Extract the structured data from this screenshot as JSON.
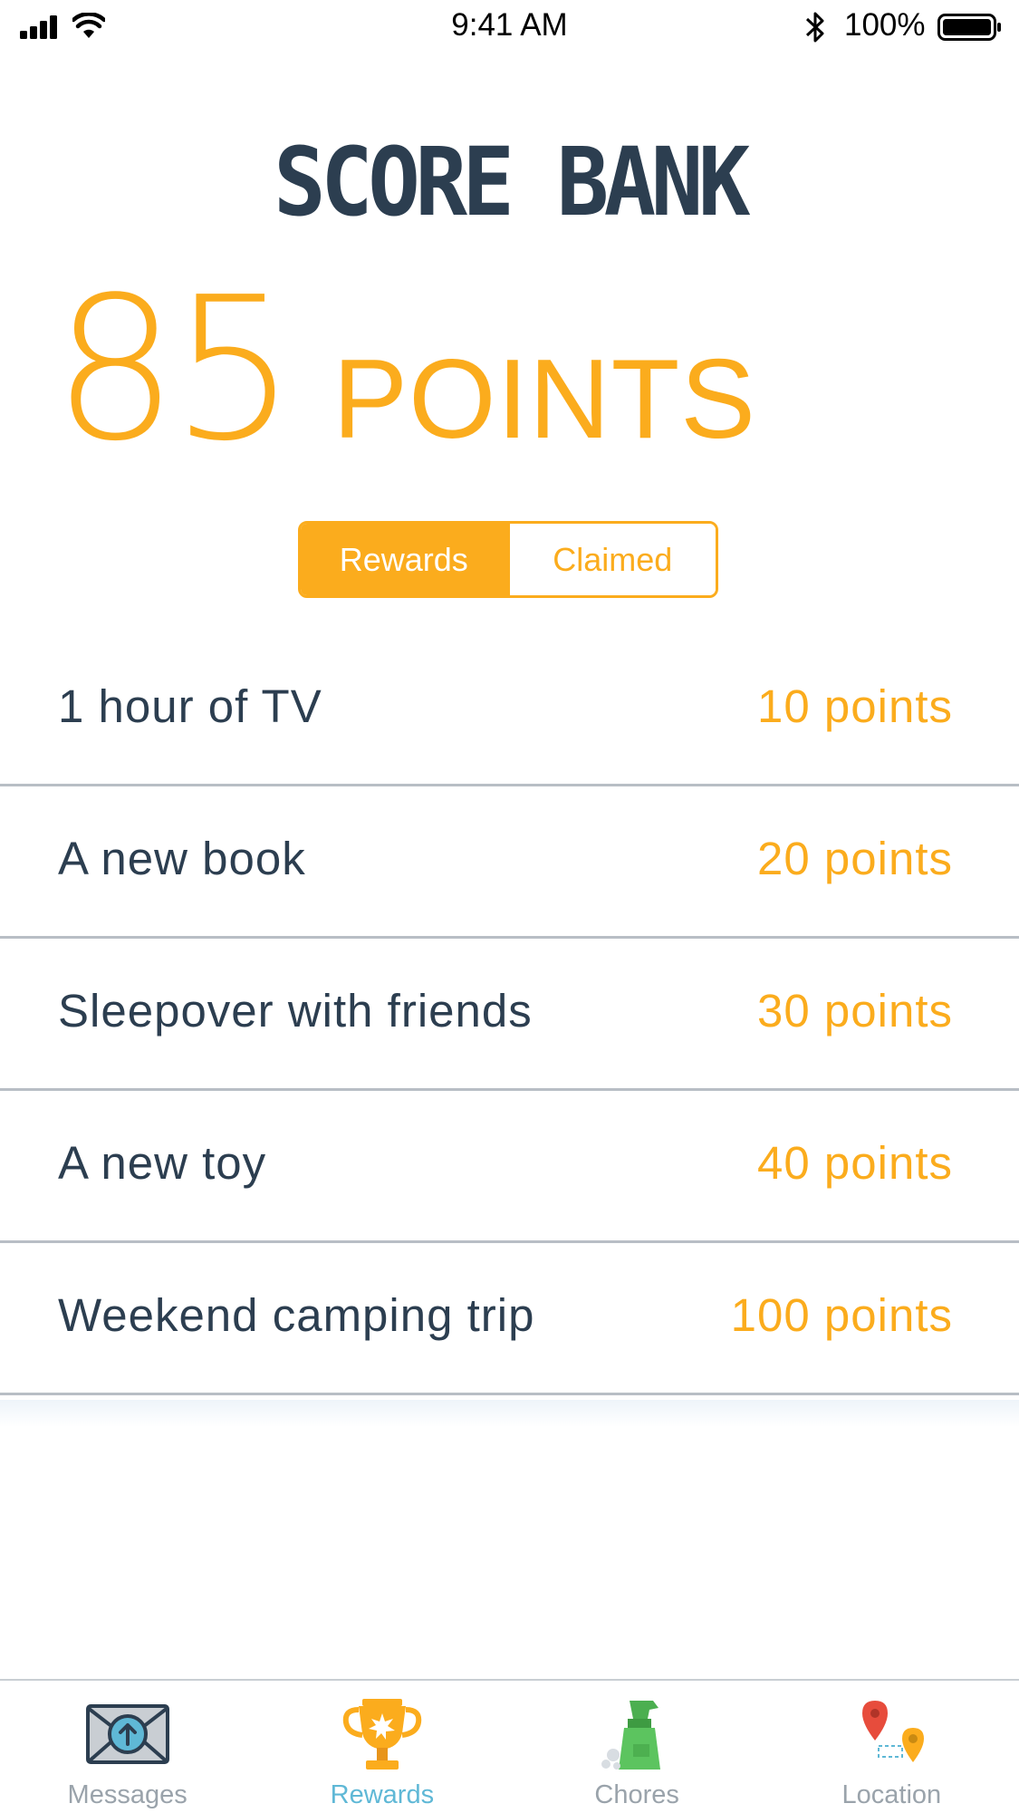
{
  "status_bar": {
    "time": "9:41 AM",
    "battery_percent": "100%",
    "icons": [
      "signal-icon",
      "wifi-icon",
      "bluetooth-icon",
      "battery-icon"
    ]
  },
  "header": {
    "title": "SCORE BANK"
  },
  "balance": {
    "value": "85",
    "unit": "POINTS"
  },
  "segmented": {
    "options": [
      "Rewards",
      "Claimed"
    ],
    "selected": "Rewards"
  },
  "rewards": [
    {
      "name": "1 hour of TV",
      "cost": "10 points"
    },
    {
      "name": "A new book",
      "cost": "20 points"
    },
    {
      "name": "Sleepover with friends",
      "cost": "30 points"
    },
    {
      "name": "A new toy",
      "cost": "40 points"
    },
    {
      "name": "Weekend camping trip",
      "cost": "100 points"
    }
  ],
  "tabbar": {
    "selected": "Rewards",
    "tabs": [
      {
        "label": "Messages",
        "icon": "envelope-icon"
      },
      {
        "label": "Rewards",
        "icon": "trophy-icon"
      },
      {
        "label": "Chores",
        "icon": "spray-bottle-icon"
      },
      {
        "label": "Location",
        "icon": "map-pins-icon"
      }
    ]
  },
  "colors": {
    "accent": "#fbac1d",
    "text_dark": "#2c3e50",
    "tab_selected": "#5fb8d6",
    "tab_inactive": "#9aa3ab",
    "divider": "#b8bec5"
  }
}
